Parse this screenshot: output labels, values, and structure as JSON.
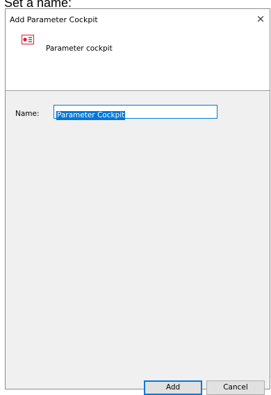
{
  "caption": "Set a name:",
  "dialog": {
    "title": "Add Parameter Cockpit",
    "close_glyph": "×",
    "header": {
      "icon": "parameter-cockpit-icon",
      "label": "Parameter cockpit"
    },
    "form": {
      "name_label": "Name:",
      "name_value": "Parameter Cockpit"
    },
    "buttons": {
      "add_label": "Add",
      "cancel_label": "Cancel"
    },
    "colors": {
      "accent": "#0078d7",
      "icon_red": "#e0192f"
    }
  }
}
